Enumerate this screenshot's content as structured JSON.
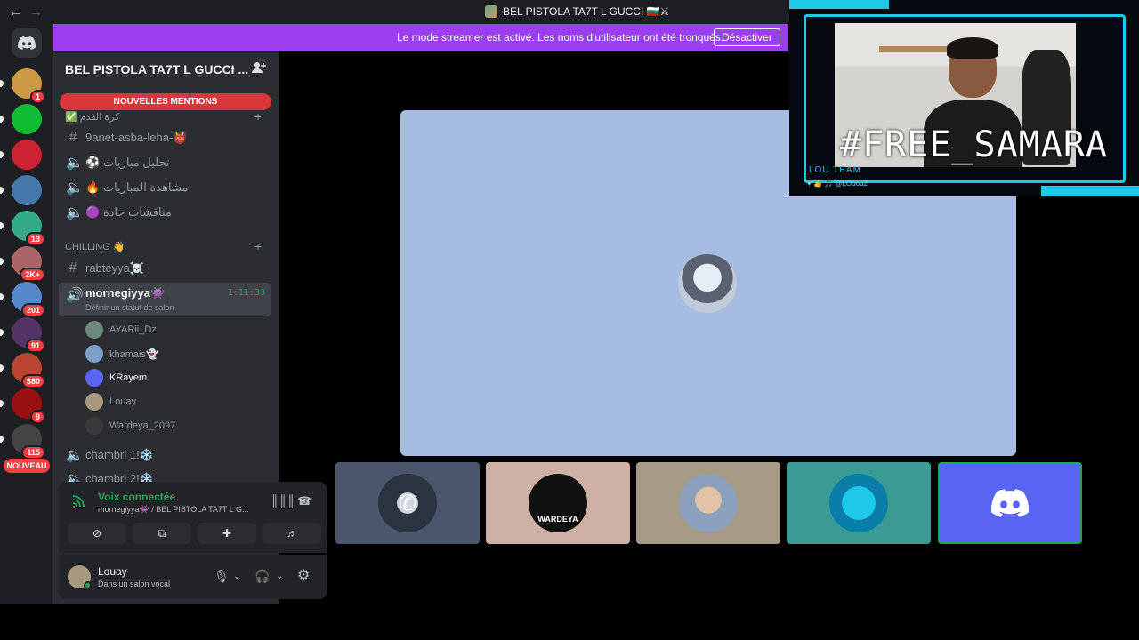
{
  "window": {
    "title": "BEL PISTOLA TA7T L GUCCI 🇧🇬⚔"
  },
  "banner": {
    "text": "Le mode streamer est activé. Les noms d'utilisateur ont été tronqués.",
    "button": "Désactiver"
  },
  "guilds": [
    {
      "badge": "1",
      "color": "#c94"
    },
    {
      "badge": "",
      "color": "#1b3"
    },
    {
      "badge": "",
      "color": "#c23"
    },
    {
      "badge": "",
      "color": "#47a"
    },
    {
      "badge": "13",
      "color": "#3a8"
    },
    {
      "badge": "2K+",
      "color": "#a66"
    },
    {
      "badge": "201",
      "color": "#58c"
    },
    {
      "badge": "91",
      "color": "#536"
    },
    {
      "badge": "380",
      "color": "#b43"
    },
    {
      "badge": "9",
      "color": "#911"
    },
    {
      "badge": "115",
      "color": "#444"
    }
  ],
  "new_label": "NOUVEAU",
  "server": {
    "name": "BEL PISTOLA TA7T L GUCCI ...",
    "new_mentions": "NOUVELLES MENTIONS",
    "category1": "✅ كرة القدم",
    "channels1": [
      {
        "type": "text",
        "name": "9anet-asba-leha-👹"
      },
      {
        "type": "voice",
        "name": "⚽ تحليل مباريات"
      },
      {
        "type": "voice",
        "name": "🔥 مشاهدة المباريات"
      },
      {
        "type": "voice",
        "name": "🟣 مناقشات حادة"
      }
    ],
    "category2": "CHILLING 👋",
    "text_channel": "rabteyya☠️",
    "active_voice": {
      "name": "mornegiyya👾",
      "timer": "1:11:33",
      "status": "Définir un statut de salon"
    },
    "voice_users": [
      "AYARii_Dz",
      "khamais👻",
      "KRayem",
      "Louay",
      "Wardeya_2097"
    ],
    "more_channels": [
      "chambri 1!❄️",
      "chambri 2!❄️"
    ]
  },
  "voice_panel": {
    "title": "Voix connectée",
    "subtitle": "mornegiyya👾 / BEL PISTOLA TA7T L G..."
  },
  "user_panel": {
    "name": "Louay",
    "status": "Dans un salon vocal"
  },
  "tiles": [
    {
      "bg": "#4a566b"
    },
    {
      "bg": "#cfb0a6",
      "label": "WARDEYA"
    },
    {
      "bg": "#a59a84"
    },
    {
      "bg": "#3a9b95"
    },
    {
      "bg": "#5865f2"
    }
  ],
  "stream_overlay": {
    "hashtag": "#FREE_SAMARA",
    "team": "LOU TEAM",
    "handle": "@LOoou2"
  }
}
